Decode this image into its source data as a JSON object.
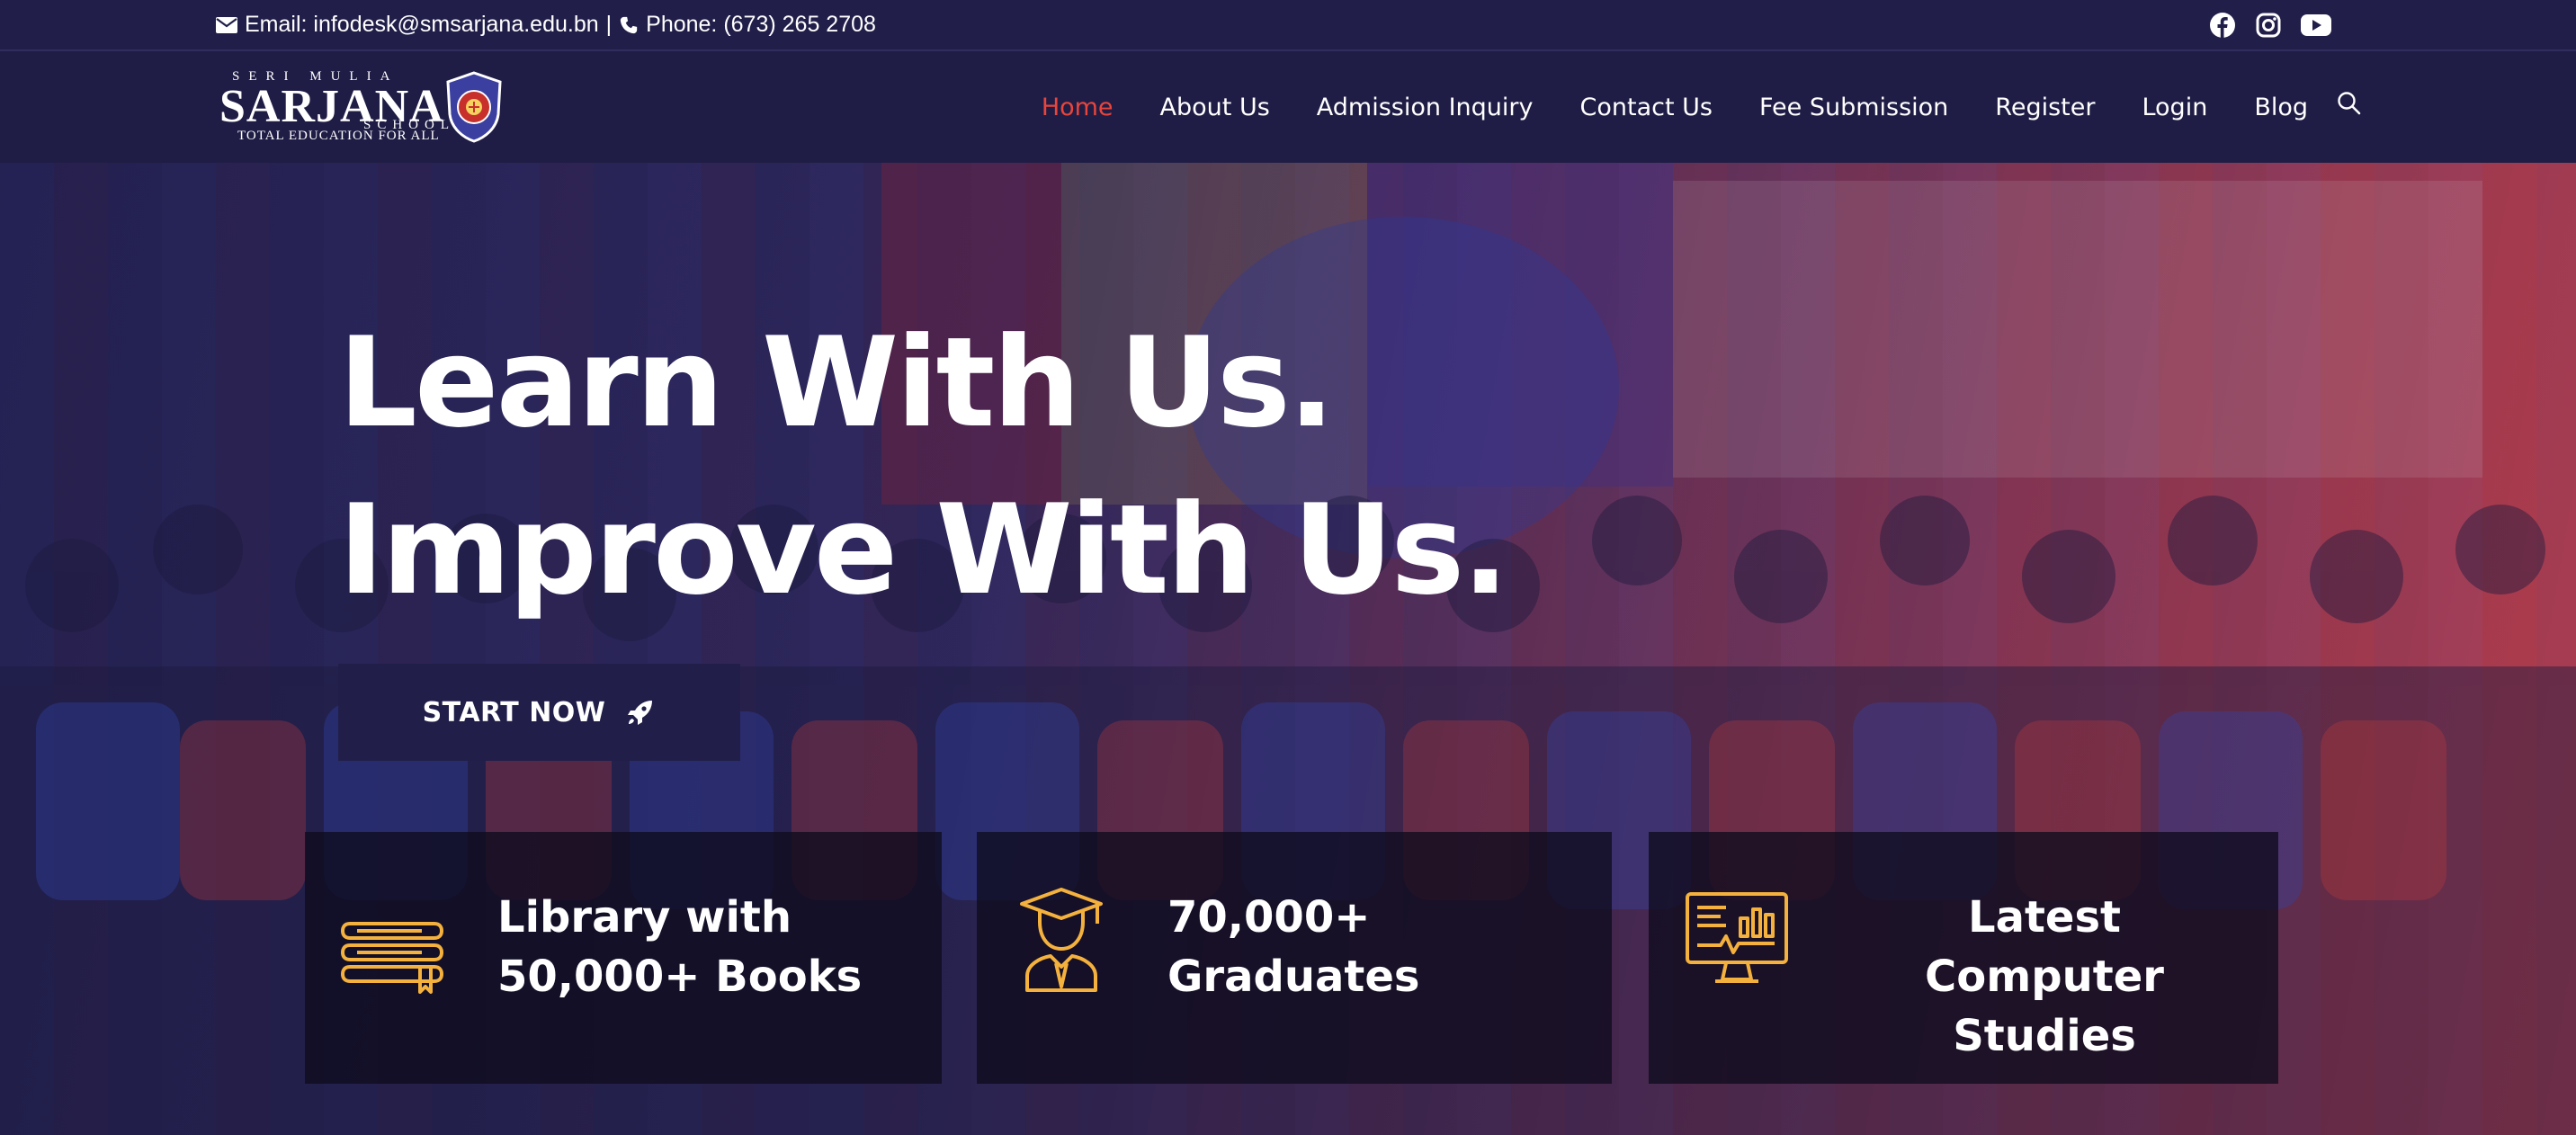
{
  "topbar": {
    "email": "Email: infodesk@smsarjana.edu.bn",
    "separator": "|",
    "phone": "Phone: (673) 265 2708",
    "social_icons": [
      "facebook-icon",
      "instagram-icon",
      "youtube-icon"
    ]
  },
  "logo": {
    "top_text": "SERI MULIA",
    "name": "SARJANA",
    "school": "SCHOOL",
    "tagline": "TOTAL EDUCATION FOR ALL"
  },
  "nav": {
    "items": [
      {
        "label": "Home",
        "active": true
      },
      {
        "label": "About Us"
      },
      {
        "label": "Admission Inquiry"
      },
      {
        "label": "Contact Us"
      },
      {
        "label": "Fee Submission"
      },
      {
        "label": "Register"
      },
      {
        "label": "Login"
      },
      {
        "label": "Blog"
      }
    ],
    "search_icon": "search-icon"
  },
  "hero": {
    "line1": "Learn With Us.",
    "line2": "Improve With Us.",
    "button_label": "START NOW",
    "button_icon": "rocket-icon"
  },
  "features": [
    {
      "line1": "Library with",
      "line2": "50,000+ Books",
      "icon": "books-icon"
    },
    {
      "line1": "70,000+",
      "line2": "Graduates",
      "icon": "graduate-icon"
    },
    {
      "line1": "Latest Computer",
      "line2": "Studies",
      "icon": "computer-monitor-icon"
    }
  ],
  "colors": {
    "navy": "#1f1d45",
    "active_red": "#e8453c",
    "icon_gold": "#f4b13d"
  }
}
